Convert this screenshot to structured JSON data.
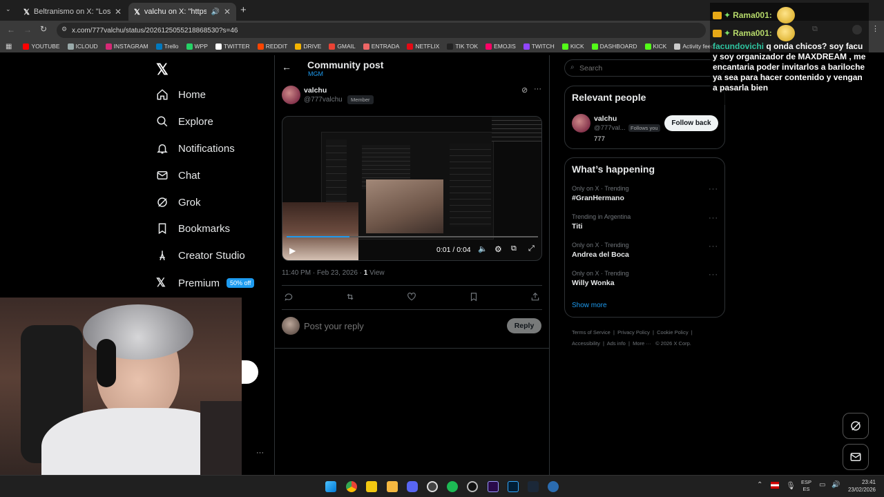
{
  "browser": {
    "tabs": [
      {
        "title": "Beltranismo on X: \"Los candidat"
      },
      {
        "title": "valchu on X: \"https://t.co/x"
      }
    ],
    "url": "x.com/777valchu/status/2026125055218868530?s=46",
    "bookmarks": [
      {
        "label": "YOUTUBE",
        "color": "#ff0000"
      },
      {
        "label": "ICLOUD",
        "color": "#9aa"
      },
      {
        "label": "INSTAGRAM",
        "color": "#d62976"
      },
      {
        "label": "Trello",
        "color": "#0079bf"
      },
      {
        "label": "WPP",
        "color": "#25d366"
      },
      {
        "label": "TWITTER",
        "color": "#fff"
      },
      {
        "label": "REDDIT",
        "color": "#ff4500"
      },
      {
        "label": "DRIVE",
        "color": "#f4b400"
      },
      {
        "label": "GMAIL",
        "color": "#ea4335"
      },
      {
        "label": "ENTRADA",
        "color": "#e66"
      },
      {
        "label": "NETFLIX",
        "color": "#e50914"
      },
      {
        "label": "TIK TOK",
        "color": "#222"
      },
      {
        "label": "EMOJIS",
        "color": "#f06"
      },
      {
        "label": "TWITCH",
        "color": "#9146ff"
      },
      {
        "label": "KICK",
        "color": "#53fc18"
      },
      {
        "label": "DASHBOARD",
        "color": "#53fc18"
      },
      {
        "label": "KICK",
        "color": "#53fc18"
      },
      {
        "label": "Activity feed",
        "color": "#ccc"
      }
    ]
  },
  "sidebar": {
    "items": [
      {
        "label": "Home"
      },
      {
        "label": "Explore"
      },
      {
        "label": "Notifications"
      },
      {
        "label": "Chat"
      },
      {
        "label": "Grok"
      },
      {
        "label": "Bookmarks"
      },
      {
        "label": "Creator Studio"
      },
      {
        "label": "Premium"
      }
    ],
    "premium_badge": "50% off"
  },
  "post": {
    "header_title": "Community post",
    "community": "MGM",
    "author_name": "valchu",
    "author_handle": "@777valchu",
    "author_badge": "Member",
    "video_time": "0:01 / 0:04",
    "video_progress": 0.25,
    "timestamp": "11:40 PM · Feb 23, 2026 · ",
    "views_count": "1",
    "views_label": " View",
    "reply_placeholder": "Post your reply",
    "reply_button": "Reply"
  },
  "right": {
    "search_placeholder": "Search",
    "relevant_title": "Relevant people",
    "person_name": "valchu",
    "person_handle": "@777val...",
    "follows_you": "Follows you",
    "person_bio": "777",
    "follow_button": "Follow back",
    "happening_title": "What’s happening",
    "trends": [
      {
        "context": "Only on X · Trending",
        "name": "#GranHermano"
      },
      {
        "context": "Trending in Argentina",
        "name": "Titi"
      },
      {
        "context": "Only on X · Trending",
        "name": "Andrea del Boca"
      },
      {
        "context": "Only on X · Trending",
        "name": "Willy Wonka"
      }
    ],
    "show_more": "Show more",
    "footer": [
      "Terms of Service",
      "Privacy Policy",
      "Cookie Policy",
      "Accessibility",
      "Ads info",
      "More ···",
      "© 2026 X Corp."
    ]
  },
  "chat_overlay": {
    "user1": "Rama001:",
    "user2": "Rama001:",
    "user3": "facundovichi",
    "message": "q onda chicos? soy facu y soy organizador de MAXDREAM , me encantaria poder invitarlos a bariloche ya sea para hacer contenido y vengan a pasarla bien"
  },
  "taskbar": {
    "lang": "ESP",
    "lang2": "ES",
    "time": "23:41",
    "date": "23/02/2026"
  },
  "colors": {
    "accent": "#1d9bf0",
    "bg": "#000000",
    "border": "#2f3336"
  }
}
